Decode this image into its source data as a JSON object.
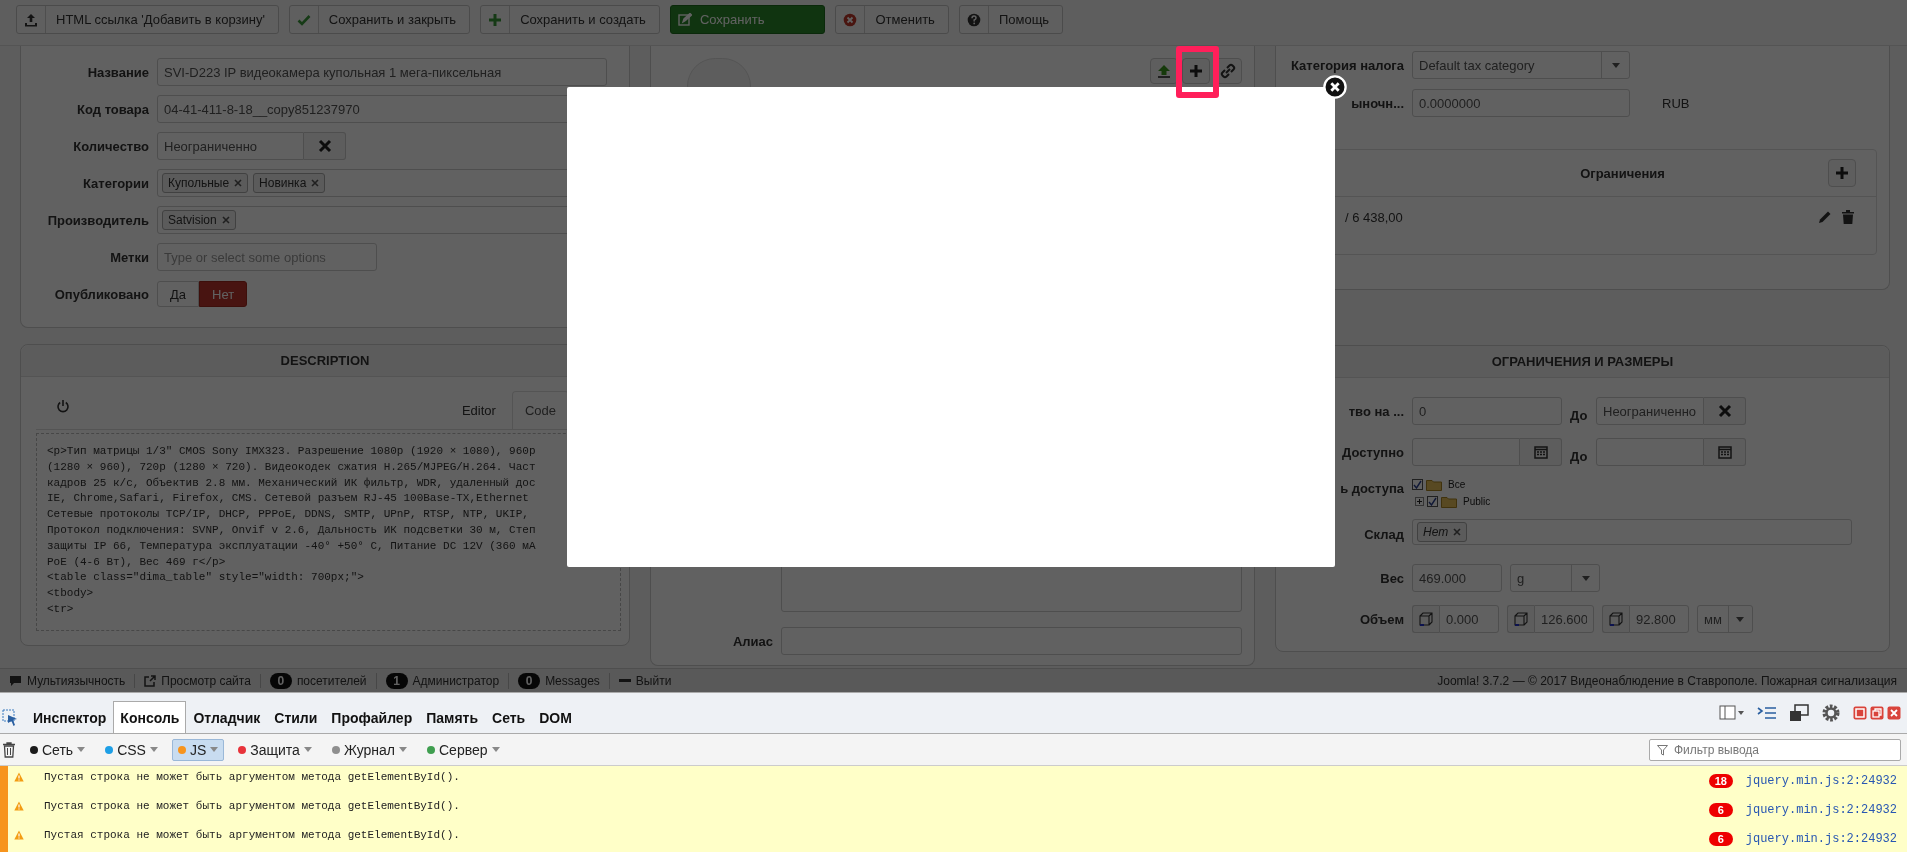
{
  "toolbar": {
    "buttons": [
      {
        "label": "HTML ссылка 'Добавить в корзину'",
        "primary": false
      },
      {
        "label": "Сохранить и закрыть",
        "primary": false
      },
      {
        "label": "Сохранить и создать",
        "primary": false
      },
      {
        "label": "Сохранить",
        "primary": true
      },
      {
        "label": "Отменить",
        "primary": false
      },
      {
        "label": "Помощь",
        "primary": false
      }
    ]
  },
  "details_form": {
    "fields": [
      {
        "label": "Название",
        "kind": "text",
        "value": "SVI-D223 IP видеокамера купольная 1 мега-пиксельная"
      },
      {
        "label": "Код товара",
        "kind": "text",
        "value": "04-41-411-8-18__copy851237970"
      },
      {
        "label": "Количество",
        "kind": "clearable",
        "value": "Неограниченно"
      },
      {
        "label": "Категории",
        "kind": "tags",
        "tags": [
          "Купольные",
          "Новинка"
        ]
      },
      {
        "label": "Производитель",
        "kind": "tags",
        "tags": [
          "Satvision"
        ]
      },
      {
        "label": "Метки",
        "kind": "text",
        "placeholder": "Type or select some options"
      },
      {
        "label": "Опубликовано",
        "kind": "toggle",
        "options": [
          {
            "label": "Да",
            "selected": false
          },
          {
            "label": "Нет",
            "selected": true
          }
        ]
      }
    ]
  },
  "description": {
    "title": "DESCRIPTION",
    "tabs": [
      {
        "label": "Editor",
        "selected": false
      },
      {
        "label": "Code",
        "selected": true
      }
    ],
    "code": "<p>Тип матрицы 1/3\" CMOS Sony IMX323. Разрешение 1080p (1920 × 1080), 960p\n(1280 × 960), 720p (1280 × 720). Видеокодек сжатия H.265/MJPEG/H.264. Част\nкадров 25 к/с, Объектив 2.8 мм. Механический ИК фильтр, WDR, удаленный дос\nIE, Chrome,Safari, Firefox, CMS. Сетевой разъем RJ-45 100Base-TX,Ethernet\nСетевые протоколы TCP/IP, DHCP, PPPoE, DDNS, SMTP, UPnP, RTSP, NTP, UKIP,\nПротокол подключения: SVNP, Onvif v 2.6, Дальность ИК подсветки 30 м, Степ\nзащиты IP 66, Температура эксплуатации -40° +50° C, Питание DC 12V (360 мА\nPoE (4-6 Вт), Вес 469 г</p>\n<table class=\"dima_table\" style=\"width: 700px;\">\n<tbody>\n<tr>"
  },
  "media": {
    "alias_label": "Алиас"
  },
  "pricing": {
    "tax_label": "Категория налога",
    "tax_value": "Default tax category",
    "price_label": "ыночн...",
    "price_value": "0.0000000",
    "currency": "RUB",
    "prices_table": {
      "columns": [
        "Ограничения"
      ],
      "rows": [
        {
          "value": "/ 6 438,00"
        }
      ]
    }
  },
  "limits": {
    "title": "ОГРАНИЧЕНИЯ И РАЗМЕРЫ",
    "quantity_label": "тво на ...",
    "quantity_value": "0",
    "quantity_to_label": "До",
    "quantity_to_value": "Неограниченно",
    "available_label": "Доступно",
    "available_to_label": "До",
    "access_label": "ь доступа",
    "access_tree": [
      {
        "label": "Все",
        "checked": true,
        "children": [
          {
            "label": "Public",
            "checked": true,
            "expanded": false
          }
        ]
      }
    ],
    "warehouse_label": "Склад",
    "warehouse_tags": [
      "Нет"
    ],
    "weight_label": "Вес",
    "weight_value": "469.000",
    "weight_unit": "g",
    "volume_label": "Объем",
    "volume_values": [
      "0.000",
      "126.600",
      "92.800"
    ],
    "volume_unit": "мм"
  },
  "status_bar": {
    "items": [
      {
        "kind": "link",
        "label": "Мультиязычность"
      },
      {
        "kind": "link",
        "label": "Просмотр сайта"
      },
      {
        "kind": "count",
        "count": "0",
        "label": "посетителей"
      },
      {
        "kind": "count",
        "count": "1",
        "label": "Администратор"
      },
      {
        "kind": "count",
        "count": "0",
        "label": "Messages"
      },
      {
        "kind": "logout",
        "label": "Выйти"
      }
    ],
    "copyright": "Joomla! 3.7.2 — © 2017 Видеонаблюдение в Ставрополе. Пожарная сигнализация"
  },
  "devtools": {
    "tabs": [
      {
        "label": "Инспектор",
        "selected": false
      },
      {
        "label": "Консоль",
        "selected": true
      },
      {
        "label": "Отладчик",
        "selected": false
      },
      {
        "label": "Стили",
        "selected": false
      },
      {
        "label": "Профайлер",
        "selected": false
      },
      {
        "label": "Память",
        "selected": false
      },
      {
        "label": "Сеть",
        "selected": false
      },
      {
        "label": "DOM",
        "selected": false
      }
    ],
    "filters": [
      {
        "label": "Сеть",
        "color": "#1a1a1a",
        "selected": false
      },
      {
        "label": "CSS",
        "color": "#1e9fe6",
        "selected": false
      },
      {
        "label": "JS",
        "color": "#f7941d",
        "selected": true
      },
      {
        "label": "Защита",
        "color": "#e8333a",
        "selected": false
      },
      {
        "label": "Журнал",
        "color": "#8e8e8e",
        "selected": false
      },
      {
        "label": "Сервер",
        "color": "#3f9e4f",
        "selected": false
      }
    ],
    "filter_placeholder": "Фильтр вывода",
    "messages": [
      {
        "text": "Пустая строка не может быть аргументом метода getElementById().",
        "count": "18",
        "source": "jquery.min.js:2:24932"
      },
      {
        "text": "Пустая строка не может быть аргументом метода getElementById().",
        "count": "6",
        "source": "jquery.min.js:2:24932"
      },
      {
        "text": "Пустая строка не может быть аргументом метода getElementById().",
        "count": "6",
        "source": "jquery.min.js:2:24932"
      }
    ]
  }
}
